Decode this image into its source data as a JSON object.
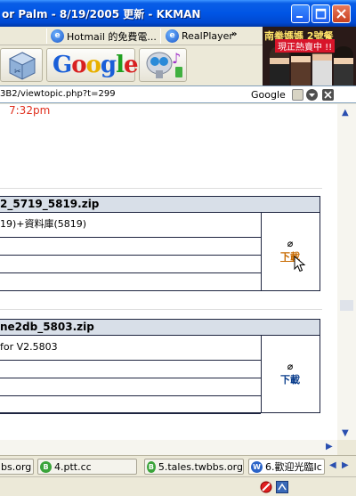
{
  "window": {
    "title": "or Palm - 8/19/2005 更新 - KKMAN"
  },
  "links_bar": {
    "items": [
      {
        "label": "Hotmail 的免費電..."
      },
      {
        "label": "RealPlayer"
      }
    ],
    "more_label": "»"
  },
  "toolbar": {
    "google_logo": "Google"
  },
  "ad": {
    "line1": "南拳媽媽 2號餐",
    "line2": "現正熱賣中 !!"
  },
  "address": {
    "url": "3B2/viewtopic.php?t=299",
    "search_label": "Google"
  },
  "content": {
    "time": "7:32pm",
    "attachments": [
      {
        "filename": "2_5719_5819.zip",
        "description": "19)+資料庫(5819)",
        "download_label": "下載",
        "clip_icon": "paperclip-icon",
        "hovered": true
      },
      {
        "filename": "ne2db_5803.zip",
        "description": "for V2.5803",
        "download_label": "下載",
        "clip_icon": "paperclip-icon",
        "hovered": false
      }
    ]
  },
  "tabs": [
    {
      "label": "bs.org",
      "icon": "b-icon",
      "active": false
    },
    {
      "label": "4.ptt.cc",
      "icon": "b-icon",
      "active": false
    },
    {
      "label": "5.tales.twbbs.org",
      "icon": "b-icon",
      "active": false
    },
    {
      "label": "6.歡迎光臨Ic",
      "icon": "w-icon",
      "active": true
    }
  ],
  "colors": {
    "titlebar": "#0055e5",
    "time_red": "#e0301e",
    "download_hover": "#c86a00",
    "download": "#0a3d8c",
    "att_header": "#d8dfe8"
  }
}
